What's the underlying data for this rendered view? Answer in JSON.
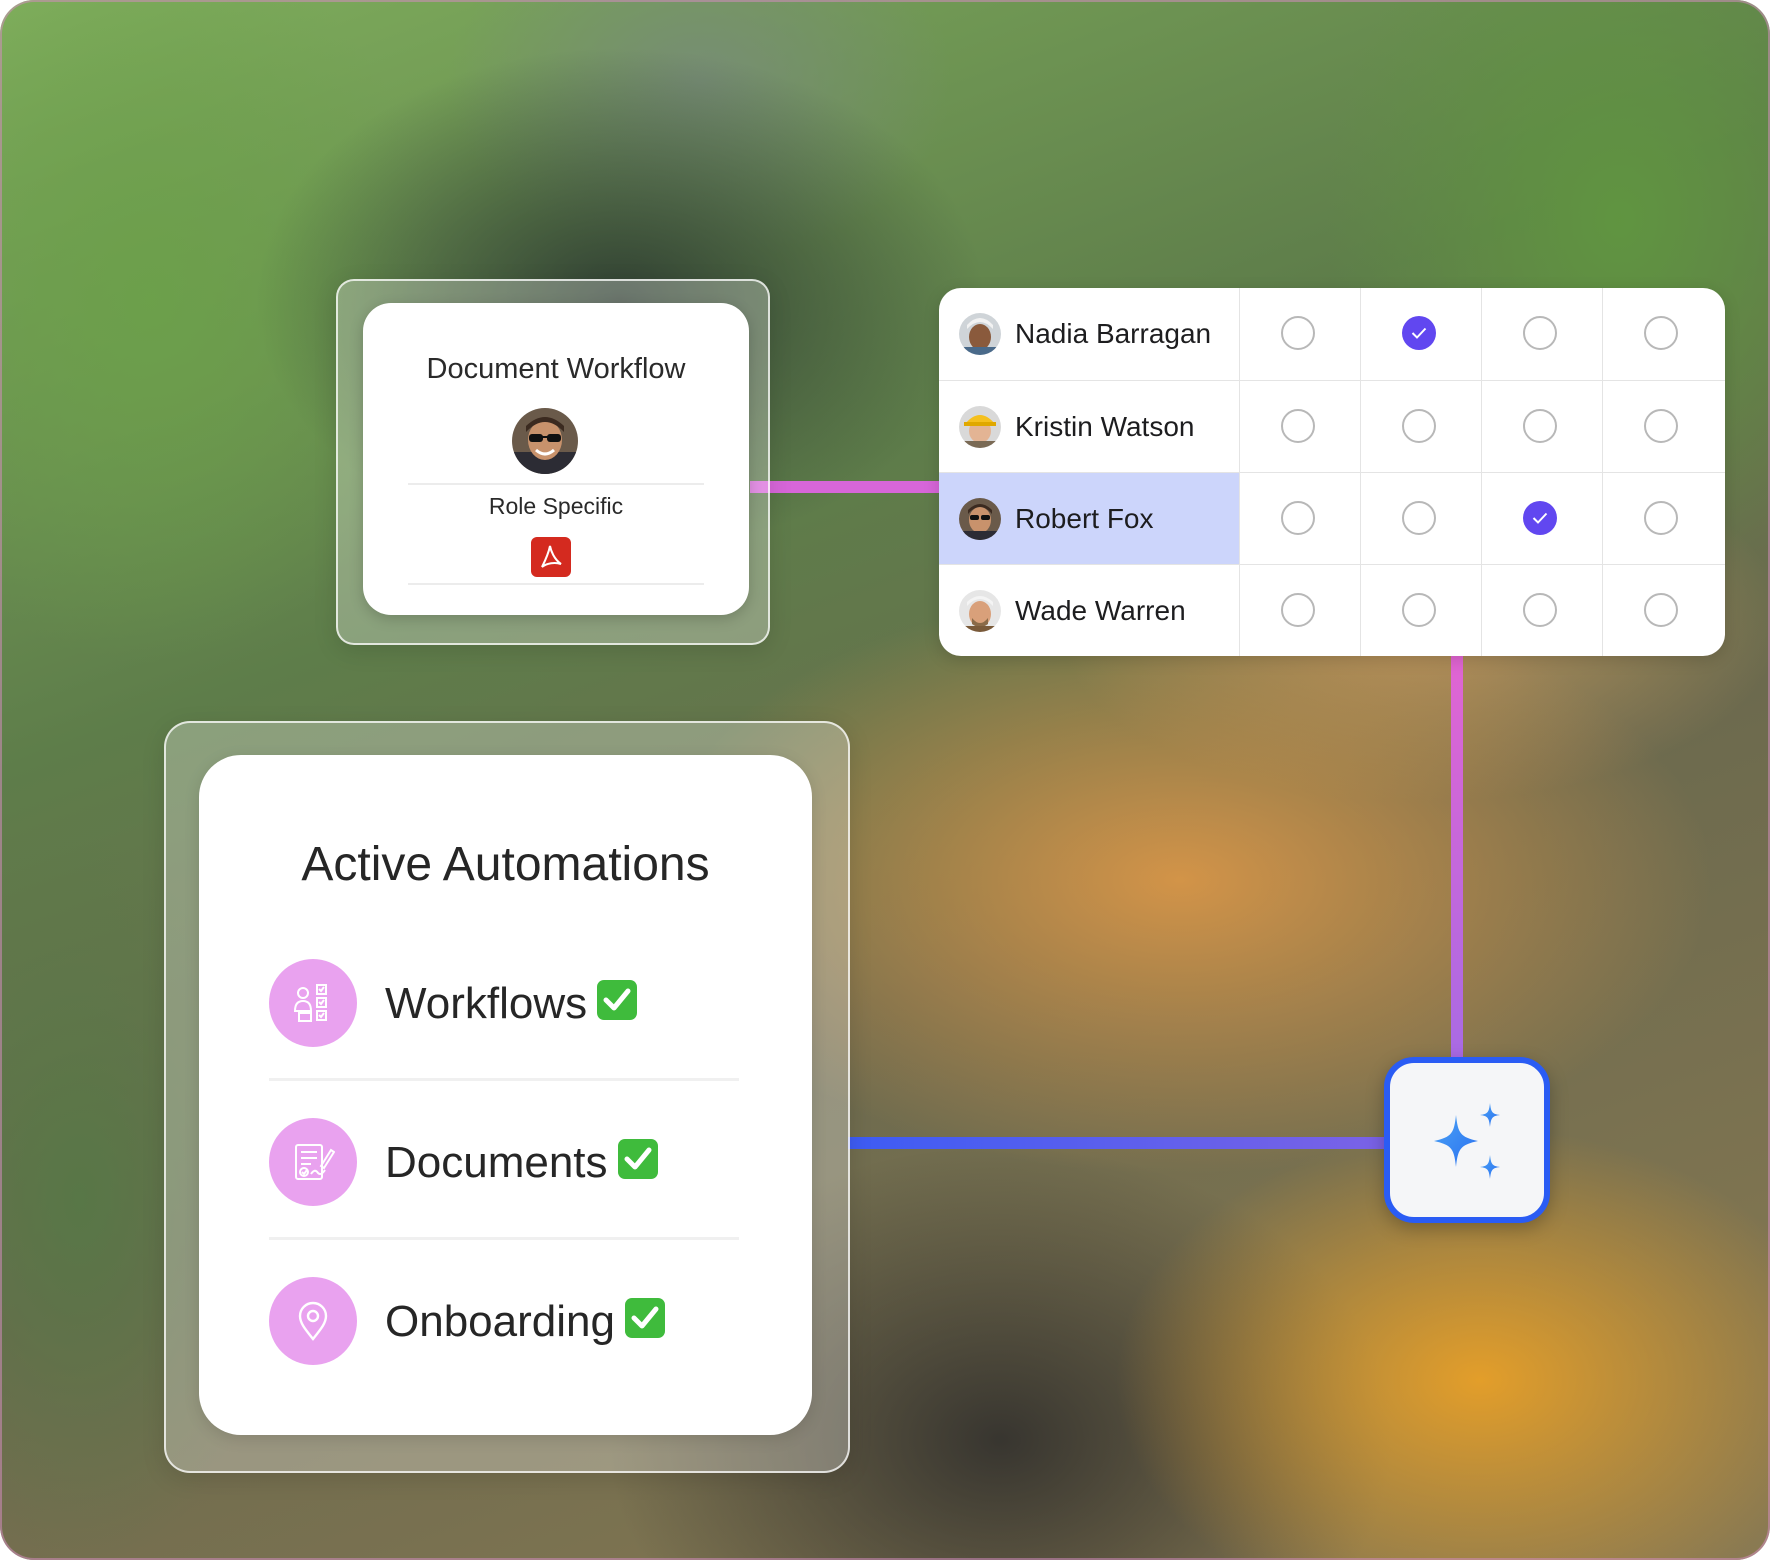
{
  "document_workflow": {
    "title": "Document Workflow",
    "role_label": "Role Specific",
    "file_icon": "pdf-icon"
  },
  "assignment_table": {
    "rows": [
      {
        "name": "Nadia Barragan",
        "checked_column": 2
      },
      {
        "name": "Kristin Watson",
        "checked_column": null
      },
      {
        "name": "Robert Fox",
        "checked_column": 3,
        "selected": true
      },
      {
        "name": "Wade Warren",
        "checked_column": null
      }
    ],
    "column_count": 4
  },
  "active_automations": {
    "title": "Active Automations",
    "items": [
      {
        "label": "Workflows",
        "icon": "workflow-checklist-icon",
        "status": "check-mark-button-emoji"
      },
      {
        "label": "Documents",
        "icon": "signed-document-icon",
        "status": "check-mark-button-emoji"
      },
      {
        "label": "Onboarding",
        "icon": "location-pin-icon",
        "status": "check-mark-button-emoji"
      }
    ]
  },
  "ai_button": {
    "icon": "sparkles-icon"
  },
  "colors": {
    "accent_purple": "#6147f0",
    "selected_row": "#ccd5fb",
    "connector_pink": "#d766d9",
    "connector_blue": "#3d5cf4",
    "icon_bubble": "#e9a2ef",
    "check_green": "#3fbb3c"
  }
}
